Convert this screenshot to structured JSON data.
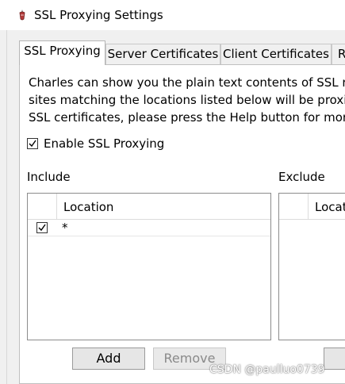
{
  "window": {
    "title": "SSL Proxying Settings",
    "icon": "charles-app-icon"
  },
  "tabs": [
    {
      "label": "SSL Proxying",
      "active": true
    },
    {
      "label": "Server Certificates",
      "active": false
    },
    {
      "label": "Client Certificates",
      "active": false
    },
    {
      "label": "R",
      "active": false
    }
  ],
  "description": [
    "Charles can show you the plain text contents of SSL req",
    "sites matching the locations listed below will be proxie",
    "SSL certificates, please press the Help button for more"
  ],
  "enable_ssl": {
    "label": "Enable SSL Proxying",
    "checked": true
  },
  "include": {
    "heading": "Include",
    "column_header": "Location",
    "rows": [
      {
        "checked": true,
        "location": "*"
      }
    ],
    "add_label": "Add",
    "remove_label": "Remove"
  },
  "exclude": {
    "heading": "Exclude",
    "column_header": "Locat"
  },
  "watermark": "CSDN @paulluo0739"
}
